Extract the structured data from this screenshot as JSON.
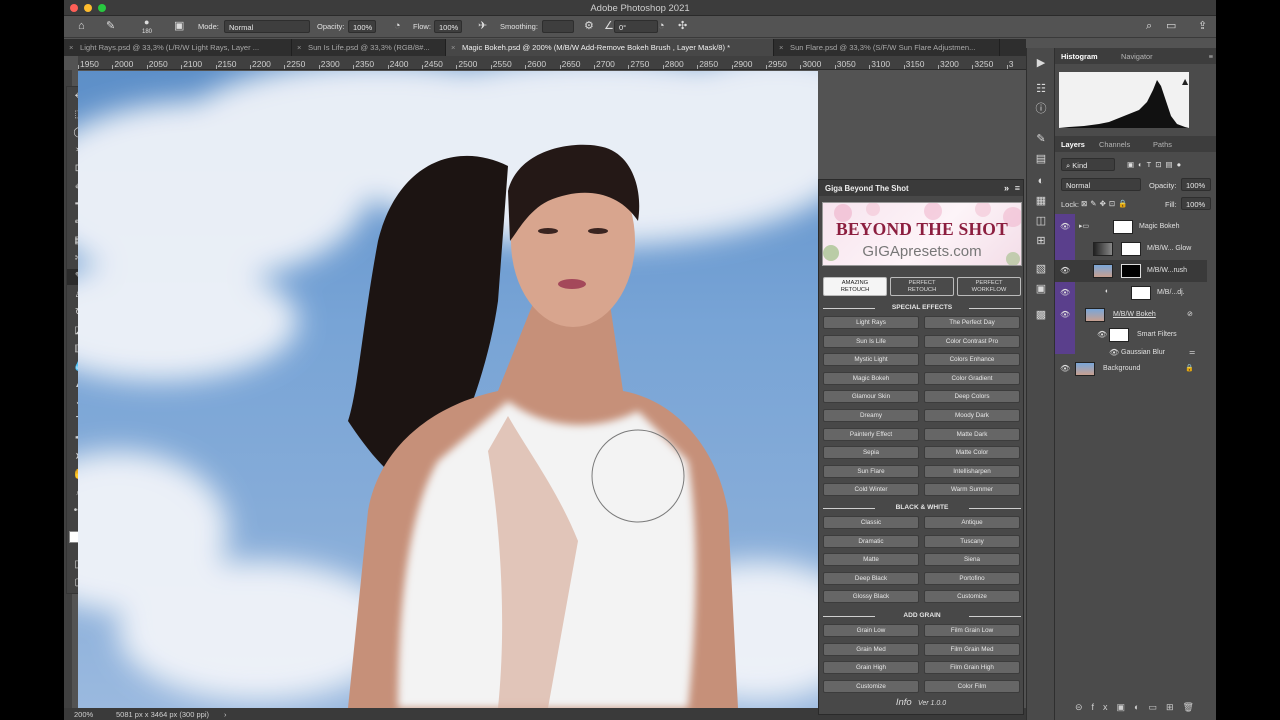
{
  "window": {
    "title": "Adobe Photoshop 2021"
  },
  "options": {
    "brush_size": "180",
    "mode_label": "Mode:",
    "mode_value": "Normal",
    "opacity_label": "Opacity:",
    "opacity_value": "100%",
    "flow_label": "Flow:",
    "flow_value": "100%",
    "smoothing_label": "Smoothing:",
    "angle_value": "0°"
  },
  "tabs": [
    {
      "label": "Light Rays.psd @ 33,3% (L/R/W Light Rays, Layer ...",
      "active": false
    },
    {
      "label": "Sun Is Life.psd @ 33,3% (RGB/8#...",
      "active": false
    },
    {
      "label": "Magic Bokeh.psd @ 200% (M/B/W Add-Remove Bokeh  Brush , Layer Mask/8) *",
      "active": true
    },
    {
      "label": "Sun Flare.psd @ 33,3% (S/F/W Sun Flare Adjustmen...",
      "active": false
    }
  ],
  "ruler": {
    "ticks": [
      "1950",
      "2000",
      "2050",
      "2100",
      "2150",
      "2200",
      "2250",
      "2300",
      "2350",
      "2400",
      "2450",
      "2500",
      "2550",
      "2600",
      "2650",
      "2700",
      "2750",
      "2800",
      "2850",
      "2900",
      "2950",
      "3000",
      "3050",
      "3100",
      "3150",
      "3200",
      "3250",
      "3"
    ]
  },
  "status": {
    "zoom": "200%",
    "doc_info": "5081 px x 3464 px (300 ppi)"
  },
  "plugin": {
    "title": "Giga Beyond The Shot",
    "banner_title": "BEYOND THE SHOT",
    "banner_site": "GIGApresets.com",
    "tabs": [
      {
        "l1": "AMAZING",
        "l2": "RETOUCH",
        "on": true
      },
      {
        "l1": "PERFECT",
        "l2": "RETOUCH",
        "on": false
      },
      {
        "l1": "PERFECT",
        "l2": "WORKFLOW",
        "on": false
      }
    ],
    "special_title": "SPECIAL EFFECTS",
    "special": [
      "Light Rays",
      "The Perfect Day",
      "Sun Is Life",
      "Color Contrast Pro",
      "Mystic Light",
      "Colors Enhance",
      "Magic Bokeh",
      "Color Gradient",
      "Glamour Skin",
      "Deep Colors",
      "Dreamy",
      "Moody Dark",
      "Painterly Effect",
      "Matte Dark",
      "Sepia",
      "Matte Color",
      "Sun Flare",
      "Intellisharpen",
      "Cold Winter",
      "Warm Summer"
    ],
    "bw_title": "BLACK & WHITE",
    "bw": [
      "Classic",
      "Antique",
      "Dramatic",
      "Tuscany",
      "Matte",
      "Siena",
      "Deep Black",
      "Portofino",
      "Glossy Black",
      "Customize"
    ],
    "grain_title": "ADD GRAIN",
    "grain": [
      "Grain Low",
      "Film Grain Low",
      "Grain Med",
      "Film Grain Med",
      "Grain High",
      "Film Grain High",
      "Customize",
      "Color Film"
    ],
    "footer_info": "Info",
    "footer_ver": "Ver 1.0.0"
  },
  "panels": {
    "histogram_tab": "Histogram",
    "navigator_tab": "Navigator",
    "layers_tab": "Layers",
    "channels_tab": "Channels",
    "paths_tab": "Paths",
    "kind": "Kind",
    "blend": "Normal",
    "opacity_label": "Opacity:",
    "opacity": "100%",
    "lock_label": "Lock:",
    "fill_label": "Fill:",
    "fill": "100%",
    "layers": [
      {
        "name": "Magic Bokeh"
      },
      {
        "name": "M/B/W... Glow"
      },
      {
        "name": "M/B/W...rush"
      },
      {
        "name": "M/B/...dj."
      },
      {
        "name": "M/B/W Bokeh"
      },
      {
        "name": "Smart Filters"
      },
      {
        "name": "Gaussian Blur"
      },
      {
        "name": "Background"
      }
    ]
  },
  "colors": {
    "accent": "#5a3f8c",
    "banner_title": "#8c1e3f"
  }
}
